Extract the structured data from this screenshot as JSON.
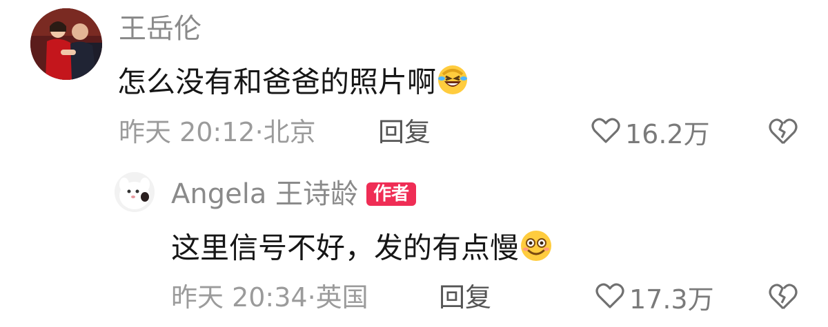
{
  "comment": {
    "username": "王岳伦",
    "text": "怎么没有和爸爸的照片啊",
    "emoji_icon": "rolling-laughing-emoji",
    "meta": "昨天 20:12·北京",
    "reply_label": "回复",
    "like_count": "16.2万"
  },
  "reply": {
    "username": "Angela 王诗龄",
    "badge": "作者",
    "text": "这里信号不好，发的有点慢",
    "emoji_icon": "smiling-emoji",
    "meta": "昨天 20:34·英国",
    "reply_label": "回复",
    "like_count": "17.3万"
  },
  "colors": {
    "badge": "#ef2d55",
    "username": "#8a8a8a",
    "text": "#161616",
    "meta": "#9b9b9b"
  },
  "icons": {
    "like": "heart-outline-icon",
    "dislike": "broken-heart-icon"
  }
}
